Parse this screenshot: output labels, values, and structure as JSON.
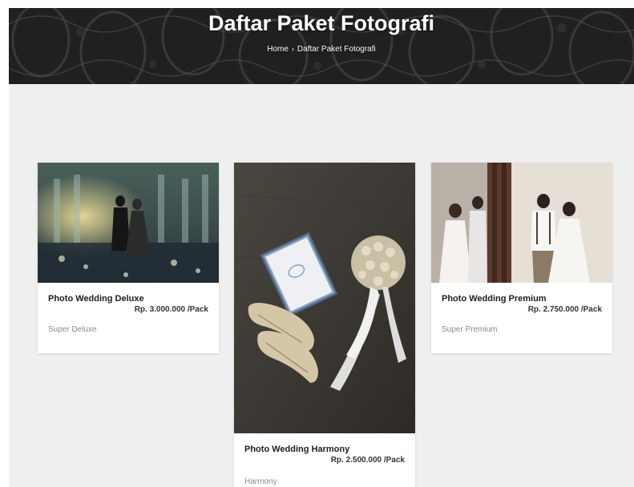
{
  "header": {
    "title": "Daftar Paket Fotografi",
    "breadcrumb": {
      "home": "Home",
      "separator": "›",
      "current": "Daftar Paket Fotografi"
    }
  },
  "packages": [
    {
      "name": "Photo Wedding Deluxe",
      "price": "Rp. 3.000.000 /Pack",
      "category": "Super Deluxe",
      "image": "wedding-couple-stage-photo"
    },
    {
      "name": "Photo Wedding Harmony",
      "price": "Rp. 2.500.000 /Pack",
      "category": "Harmony",
      "image": "bridal-shoes-bouquet-photo"
    },
    {
      "name": "Photo Wedding Premium",
      "price": "Rp. 2.750.000 /Pack",
      "category": "Super Premium",
      "image": "couple-by-window-photo"
    }
  ],
  "colors": {
    "hero_bg": "#2a2a2a",
    "content_bg": "#efefef",
    "card_bg": "#ffffff",
    "title_text": "#ffffff",
    "muted_text": "#8a8a8a"
  }
}
